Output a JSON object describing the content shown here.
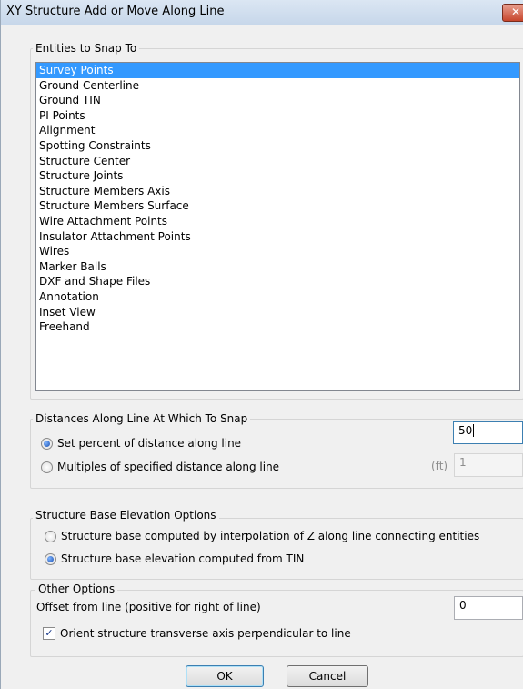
{
  "window": {
    "title": "XY Structure Add or Move Along Line",
    "close_glyph": "✕"
  },
  "entities": {
    "label": "Entities to Snap To",
    "items": [
      "Survey Points",
      "Ground Centerline",
      "Ground TIN",
      "PI Points",
      "Alignment",
      "Spotting Constraints",
      "Structure Center",
      "Structure Joints",
      "Structure Members Axis",
      "Structure Members Surface",
      "Wire Attachment Points",
      "Insulator Attachment Points",
      "Wires",
      "Marker Balls",
      "DXF and Shape Files",
      "Annotation",
      "Inset View",
      "Freehand"
    ],
    "selected": "Survey Points"
  },
  "distances": {
    "label": "Distances Along Line At Which To Snap",
    "percent_label": "Set percent of distance along line",
    "percent_value": "50",
    "multiples_label": "Multiples of specified distance along line",
    "unit": "(ft)",
    "multiples_value": "1"
  },
  "elevation": {
    "label": "Structure Base Elevation Options",
    "interp_label": "Structure base computed by interpolation of Z along line connecting entities",
    "tin_label": "Structure base elevation computed from TIN"
  },
  "other": {
    "label": "Other Options",
    "offset_label": "Offset from line (positive for right of line)",
    "offset_value": "0",
    "orient_label": "Orient structure transverse axis perpendicular to line",
    "check_glyph": "✓"
  },
  "buttons": {
    "ok": "OK",
    "cancel": "Cancel"
  },
  "colors": {
    "selection": "#3399ff",
    "dialog_bg": "#f0f0f0"
  }
}
